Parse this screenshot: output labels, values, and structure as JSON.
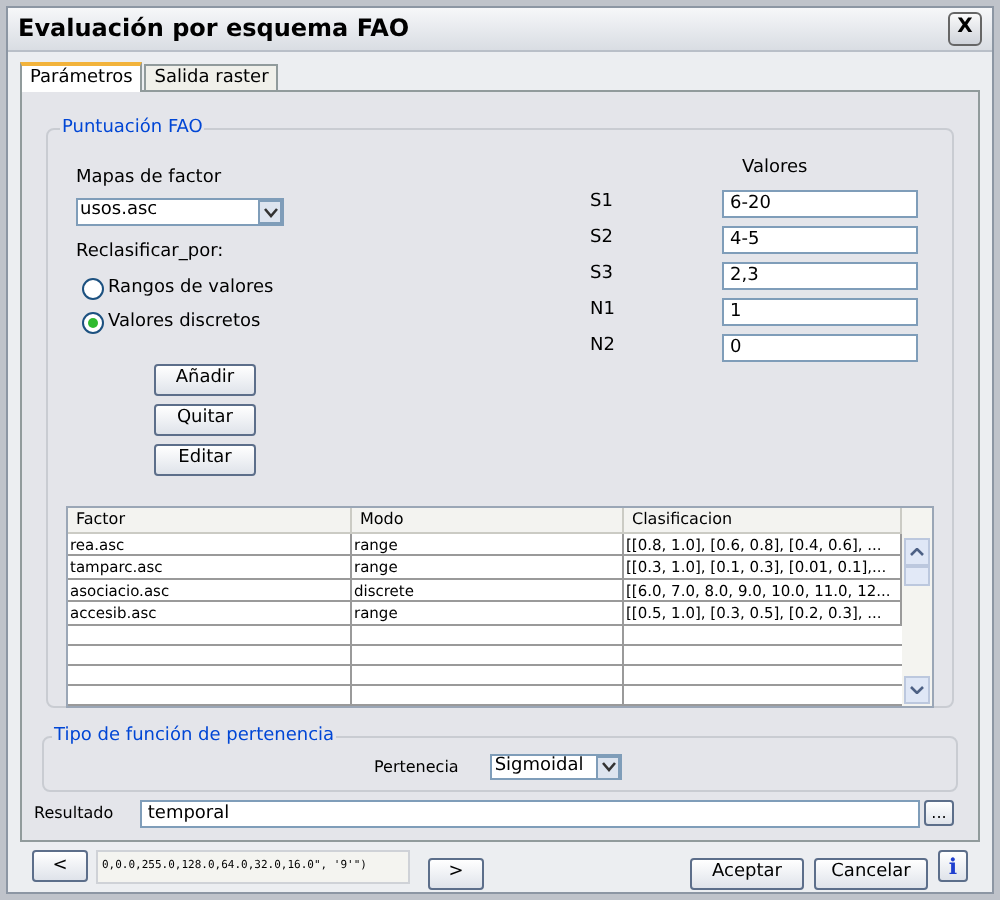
{
  "window": {
    "title": "Evaluación por esquema FAO",
    "close": "X"
  },
  "tabs": [
    {
      "label": "Parámetros",
      "selected": true
    },
    {
      "label": "Salida raster",
      "selected": false
    }
  ],
  "group": {
    "title": "Puntuación FAO",
    "factor_maps": {
      "label": "Mapas de factor",
      "value": "usos.asc"
    },
    "reclassify": {
      "label": "Reclasificar_por:",
      "options": [
        {
          "label": "Rangos de valores",
          "selected": false
        },
        {
          "label": "Valores discretos",
          "selected": true
        }
      ]
    },
    "buttons": [
      "Añadir",
      "Quitar",
      "Editar"
    ],
    "values": {
      "heading": "Valores",
      "rows": [
        {
          "label": "S1",
          "value": "6-20"
        },
        {
          "label": "S2",
          "value": "4-5"
        },
        {
          "label": "S3",
          "value": "2,3"
        },
        {
          "label": "N1",
          "value": "1"
        },
        {
          "label": "N2",
          "value": "0"
        }
      ]
    },
    "table": {
      "columns": [
        "Factor",
        "Modo",
        "Clasificacion"
      ],
      "rows": [
        [
          "rea.asc",
          "range",
          "[[0.8, 1.0], [0.6, 0.8], [0.4, 0.6], ..."
        ],
        [
          "tamparc.asc",
          "range",
          "[[0.3, 1.0], [0.1, 0.3], [0.01, 0.1],..."
        ],
        [
          "asociacio.asc",
          "discrete",
          "[[6.0, 7.0, 8.0, 9.0, 10.0, 11.0, 12..."
        ],
        [
          "accesib.asc",
          "range",
          "[[0.5, 1.0], [0.3, 0.5], [0.2, 0.3], ..."
        ]
      ]
    }
  },
  "membership": {
    "title": "Tipo de función de pertenencia",
    "label": "Pertenecia",
    "value": "Sigmoidal"
  },
  "result": {
    "label": "Resultado",
    "value": "temporal",
    "browse": "..."
  },
  "footer": {
    "prev": "<",
    "command": "0,0.0,255.0,128.0,64.0,32.0,16.0\", '9'\")",
    "next": ">",
    "buttons": [
      "Aceptar",
      "Cancelar"
    ],
    "info": "i"
  }
}
